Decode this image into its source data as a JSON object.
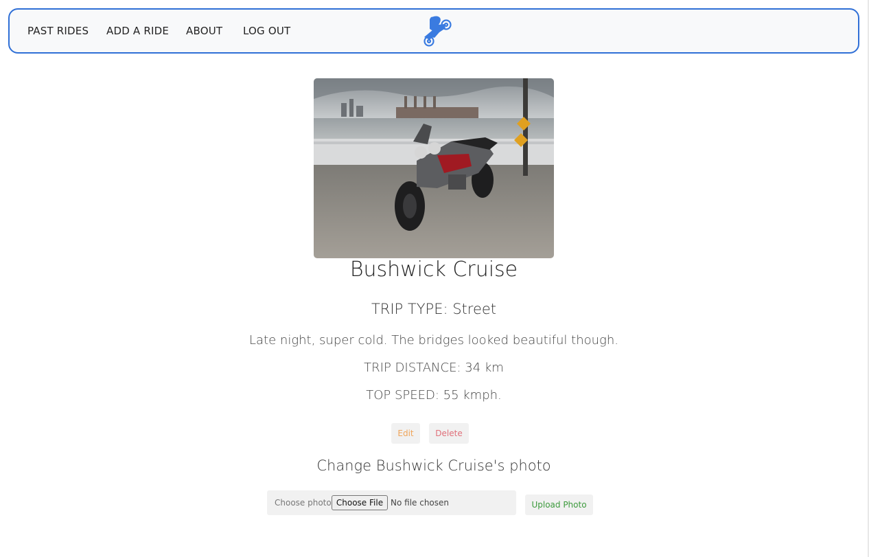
{
  "nav": {
    "links": [
      "PAST RIDES",
      "ADD A RIDE",
      "ABOUT",
      "LOG OUT"
    ],
    "logo_icon": "motorcycle-rider-icon",
    "accent_color": "#2f6fd6"
  },
  "ride": {
    "title": "Bushwick Cruise",
    "trip_type": "TRIP TYPE: Street",
    "description": "Late night, super cold. The bridges looked beautiful though.",
    "distance": "TRIP DISTANCE: 34 km",
    "top_speed": "TOP SPEED: 55 kmph."
  },
  "actions": {
    "edit_label": "Edit",
    "delete_label": "Delete"
  },
  "upload": {
    "heading": "Change Bushwick Cruise's photo",
    "file_label": "Choose photo",
    "choose_file_label": "Choose File",
    "no_file_text": "No file chosen",
    "upload_label": "Upload Photo"
  }
}
